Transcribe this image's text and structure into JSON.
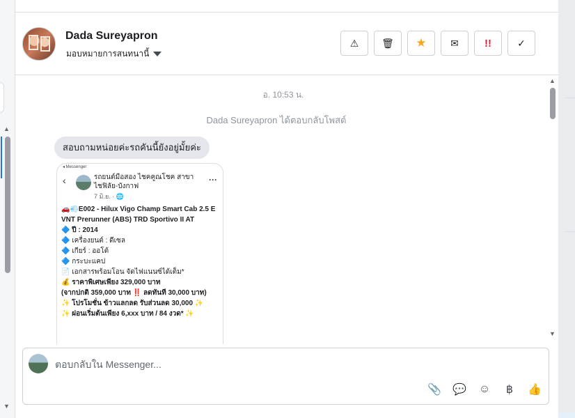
{
  "contact": {
    "name": "Dada Sureyapron",
    "assign_label": "มอบหมายการสนทนานี้"
  },
  "header_actions": [
    {
      "icon": "warning-icon",
      "glyph": "⚠"
    },
    {
      "icon": "trash-icon",
      "glyph": "🗑"
    },
    {
      "icon": "star-icon",
      "glyph": "★"
    },
    {
      "icon": "envelope-icon",
      "glyph": "✉"
    },
    {
      "icon": "urgent-icon",
      "glyph": "!!"
    },
    {
      "icon": "check-icon",
      "glyph": "✓"
    }
  ],
  "conversation": {
    "timestamp": "อ. 10:53 น.",
    "replied_notice": "Dada Sureyapron ได้ตอบกลับโพสต์",
    "message": "สอบถามหน่อยค่ะรถคันนี้ยังอยู่มั้ยค่ะ",
    "shared_post": {
      "messenger_label": "◂ Messenger",
      "page_name": "รถยนต์มือสอง ไชคคูณโชค สาขาไชฟิลัย-บังกาฟ",
      "date": "7 มิ.ย. · 🌐",
      "lines": [
        "🚗💨E002 - Hilux Vigo Champ Smart Cab 2.5 E VNT Prerunner (ABS) TRD Sportivo II AT",
        "🔷 ปี : 2014",
        "🔷 เครื่องยนต์ : ดีเซล",
        "🔷 เกียร์ : ออโต้",
        "🔷 กระบะแคป",
        "📄 เอกสารพร้อมโอน จัดไฟแนนซ์ได้เต็ม*",
        "💰 ราคาพิเศษเพียง 329,000 บาท",
        "(จากปกติ 359,000 บาท ‼️ ลดทันที 30,000 บาท)",
        "✨ โปรโมชั่น ข้าวแลกลด รับส่วนลด 30,000 ✨",
        "✨ ผ่อนเริ่มต้นเพียง 6,xxx บาท / 84 งวด* ✨"
      ]
    }
  },
  "composer": {
    "placeholder": "ตอบกลับใน Messenger..."
  },
  "composer_tools": [
    {
      "icon": "paperclip-icon",
      "glyph": "📎"
    },
    {
      "icon": "quick-reply-icon",
      "glyph": "💬"
    },
    {
      "icon": "emoji-icon",
      "glyph": "☺"
    },
    {
      "icon": "baht-icon",
      "glyph": "฿"
    },
    {
      "icon": "thumbs-up-icon",
      "glyph": "👍"
    }
  ]
}
